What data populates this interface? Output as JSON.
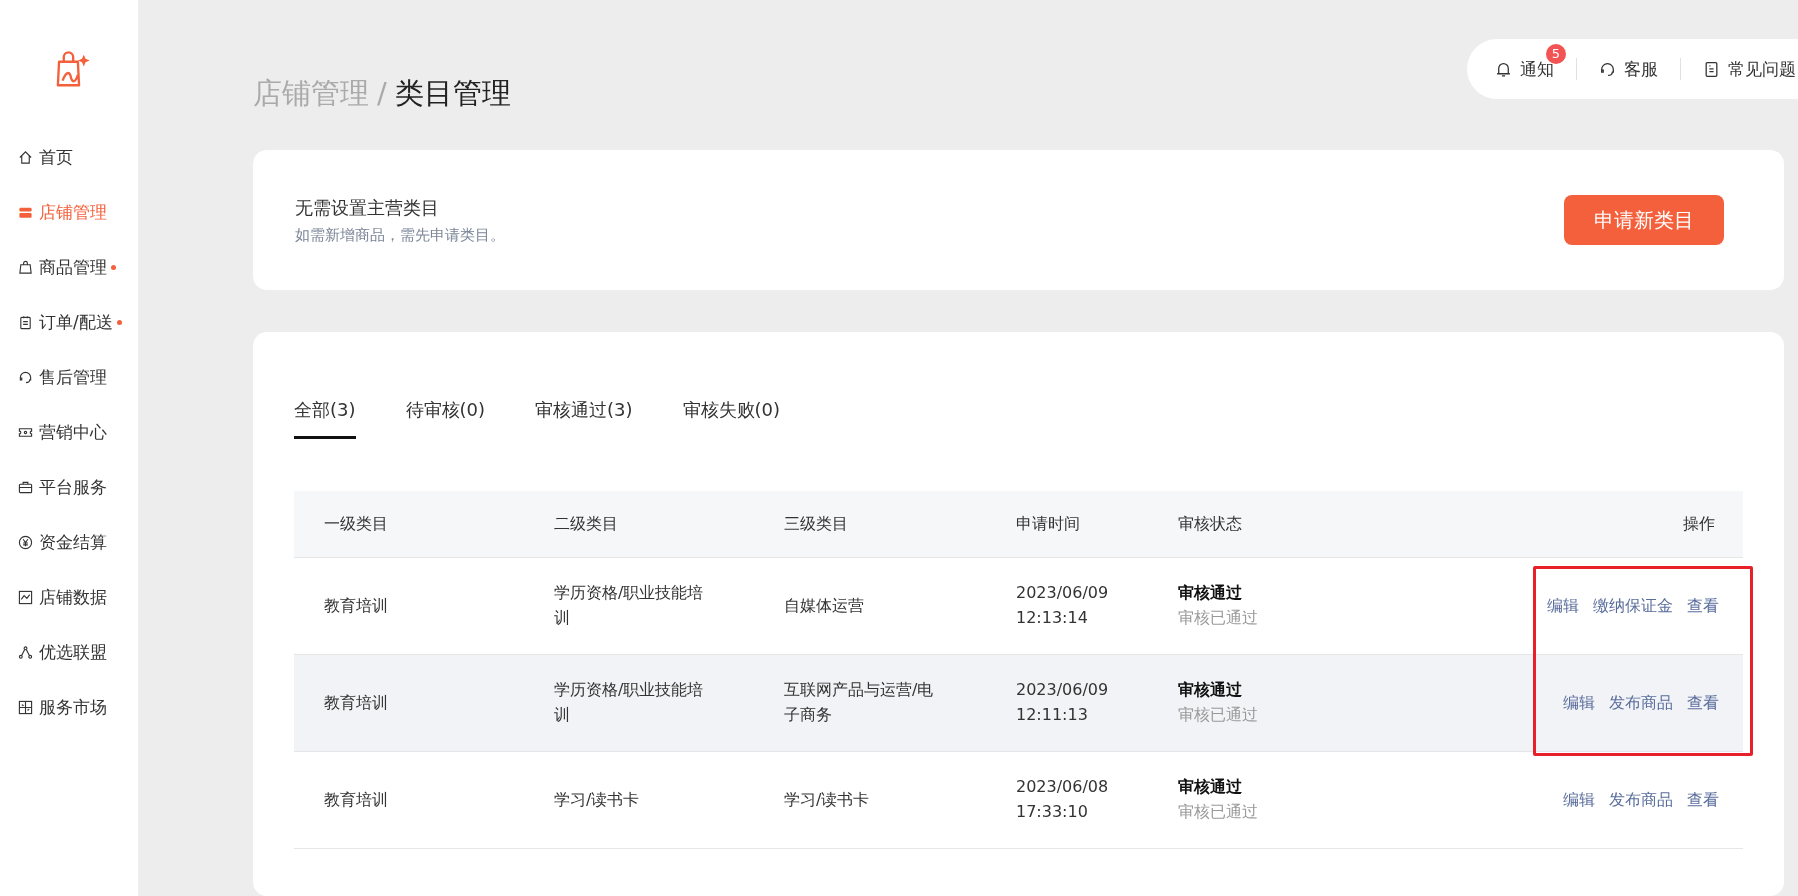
{
  "sidebar": {
    "items": [
      {
        "label": "首页",
        "selected": false,
        "dot": false
      },
      {
        "label": "店铺管理",
        "selected": true,
        "dot": false
      },
      {
        "label": "商品管理",
        "selected": false,
        "dot": true
      },
      {
        "label": "订单/配送",
        "selected": false,
        "dot": true
      },
      {
        "label": "售后管理",
        "selected": false,
        "dot": false
      },
      {
        "label": "营销中心",
        "selected": false,
        "dot": false
      },
      {
        "label": "平台服务",
        "selected": false,
        "dot": false
      },
      {
        "label": "资金结算",
        "selected": false,
        "dot": false
      },
      {
        "label": "店铺数据",
        "selected": false,
        "dot": false
      },
      {
        "label": "优选联盟",
        "selected": false,
        "dot": false
      },
      {
        "label": "服务市场",
        "selected": false,
        "dot": false
      }
    ]
  },
  "breadcrumb": {
    "parent": "店铺管理",
    "separator": "/",
    "current": "类目管理"
  },
  "topbar": {
    "items": [
      {
        "label": "通知",
        "badge": "5"
      },
      {
        "label": "客服"
      },
      {
        "label": "常见问题"
      }
    ]
  },
  "notice": {
    "title": "无需设置主营类目",
    "subtitle": "如需新增商品，需先申请类目。",
    "button": "申请新类目"
  },
  "tabs": [
    {
      "label": "全部(3)",
      "selected": true
    },
    {
      "label": "待审核(0)",
      "selected": false
    },
    {
      "label": "审核通过(3)",
      "selected": false
    },
    {
      "label": "审核失败(0)",
      "selected": false
    }
  ],
  "table": {
    "columns": [
      "一级类目",
      "二级类目",
      "三级类目",
      "申请时间",
      "审核状态",
      "操作"
    ],
    "rows": [
      {
        "level1": "教育培训",
        "level2": "学历资格/职业技能培训",
        "level3": "自媒体运营",
        "date": "2023/06/09",
        "time": "12:13:14",
        "status": "审核通过",
        "status_note": "审核已通过",
        "actions": [
          "编辑",
          "缴纳保证金",
          "查看"
        ],
        "hovered": false,
        "highlighted": true
      },
      {
        "level1": "教育培训",
        "level2": "学历资格/职业技能培训",
        "level3": "互联网产品与运营/电子商务",
        "date": "2023/06/09",
        "time": "12:11:13",
        "status": "审核通过",
        "status_note": "审核已通过",
        "actions": [
          "编辑",
          "发布商品",
          "查看"
        ],
        "hovered": true,
        "highlighted": true
      },
      {
        "level1": "教育培训",
        "level2": "学习/读书卡",
        "level3": "学习/读书卡",
        "date": "2023/06/08",
        "time": "17:33:10",
        "status": "审核通过",
        "status_note": "审核已通过",
        "actions": [
          "编辑",
          "发布商品",
          "查看"
        ],
        "hovered": false,
        "highlighted": false
      }
    ]
  }
}
